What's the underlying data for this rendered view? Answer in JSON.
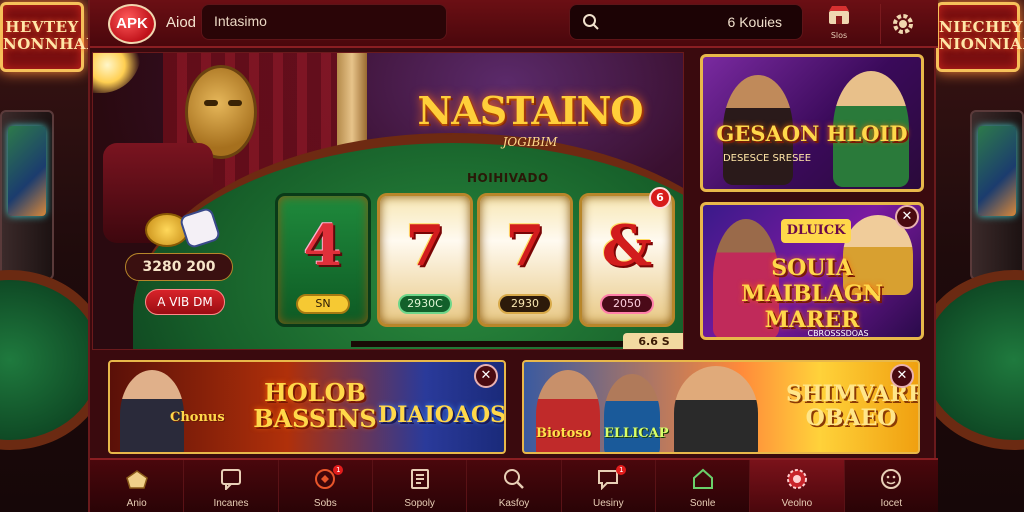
{
  "background": {
    "left_sign": "HEVTEY NONNHAL",
    "right_sign": "NIECHEY NIONNIAL"
  },
  "header": {
    "logo": "APK",
    "brand_text": "Aiod",
    "title_value": "Intasimo",
    "search_text": "6 Kouies",
    "store_label": "Slos",
    "store_icon": "store-icon",
    "settings_icon": "gear-icon"
  },
  "hero": {
    "title": "NASTAINO",
    "subtitle": "JOGIBIM",
    "reel_caption": "HOIHIVADO",
    "reels": [
      {
        "symbol": "4",
        "label": "SN"
      },
      {
        "symbol": "7",
        "label": "2930C"
      },
      {
        "symbol": "7",
        "label": "2930"
      },
      {
        "symbol": "&",
        "label": "2050"
      }
    ],
    "reel_badge": "6",
    "balance": "3280 200",
    "cta": "A VIB DM",
    "corner_label": "6.6 S"
  },
  "promos": [
    {
      "title": "GESAON HLOID",
      "subtitle": "DESESCE SRESEE"
    },
    {
      "tag": "DLUICK",
      "title": "SOUIA MAIBLAGN MARER",
      "subtitle": "CBROSSSDOAS"
    }
  ],
  "banners": [
    {
      "t1": "Chonus",
      "t2": "HOLOB BASSINS",
      "t3": "DIAIOAOS"
    },
    {
      "t1": "Biotoso",
      "t2": "ELLICAP",
      "t3": "SHIMVARR OBAEO"
    }
  ],
  "close_glyph": "✕",
  "nav": [
    {
      "label": "Anio",
      "icon": "home-icon",
      "active": false
    },
    {
      "label": "Incanes",
      "icon": "chat-icon",
      "active": false
    },
    {
      "label": "Sobs",
      "icon": "rewards-icon",
      "badge": "1",
      "active": false
    },
    {
      "label": "Sopoly",
      "icon": "ledger-icon",
      "active": false
    },
    {
      "label": "Kasfoy",
      "icon": "search-icon",
      "active": false
    },
    {
      "label": "Uesiny",
      "icon": "message-icon",
      "badge": "1",
      "active": false
    },
    {
      "label": "Sonle",
      "icon": "house-icon",
      "active": false
    },
    {
      "label": "Veolno",
      "icon": "casino-chip-icon",
      "active": true
    },
    {
      "label": "Iocet",
      "icon": "profile-icon",
      "active": false
    }
  ],
  "colors": {
    "accent": "#e8b84a",
    "brand_red": "#c0121a",
    "bar": "#4a070c"
  }
}
